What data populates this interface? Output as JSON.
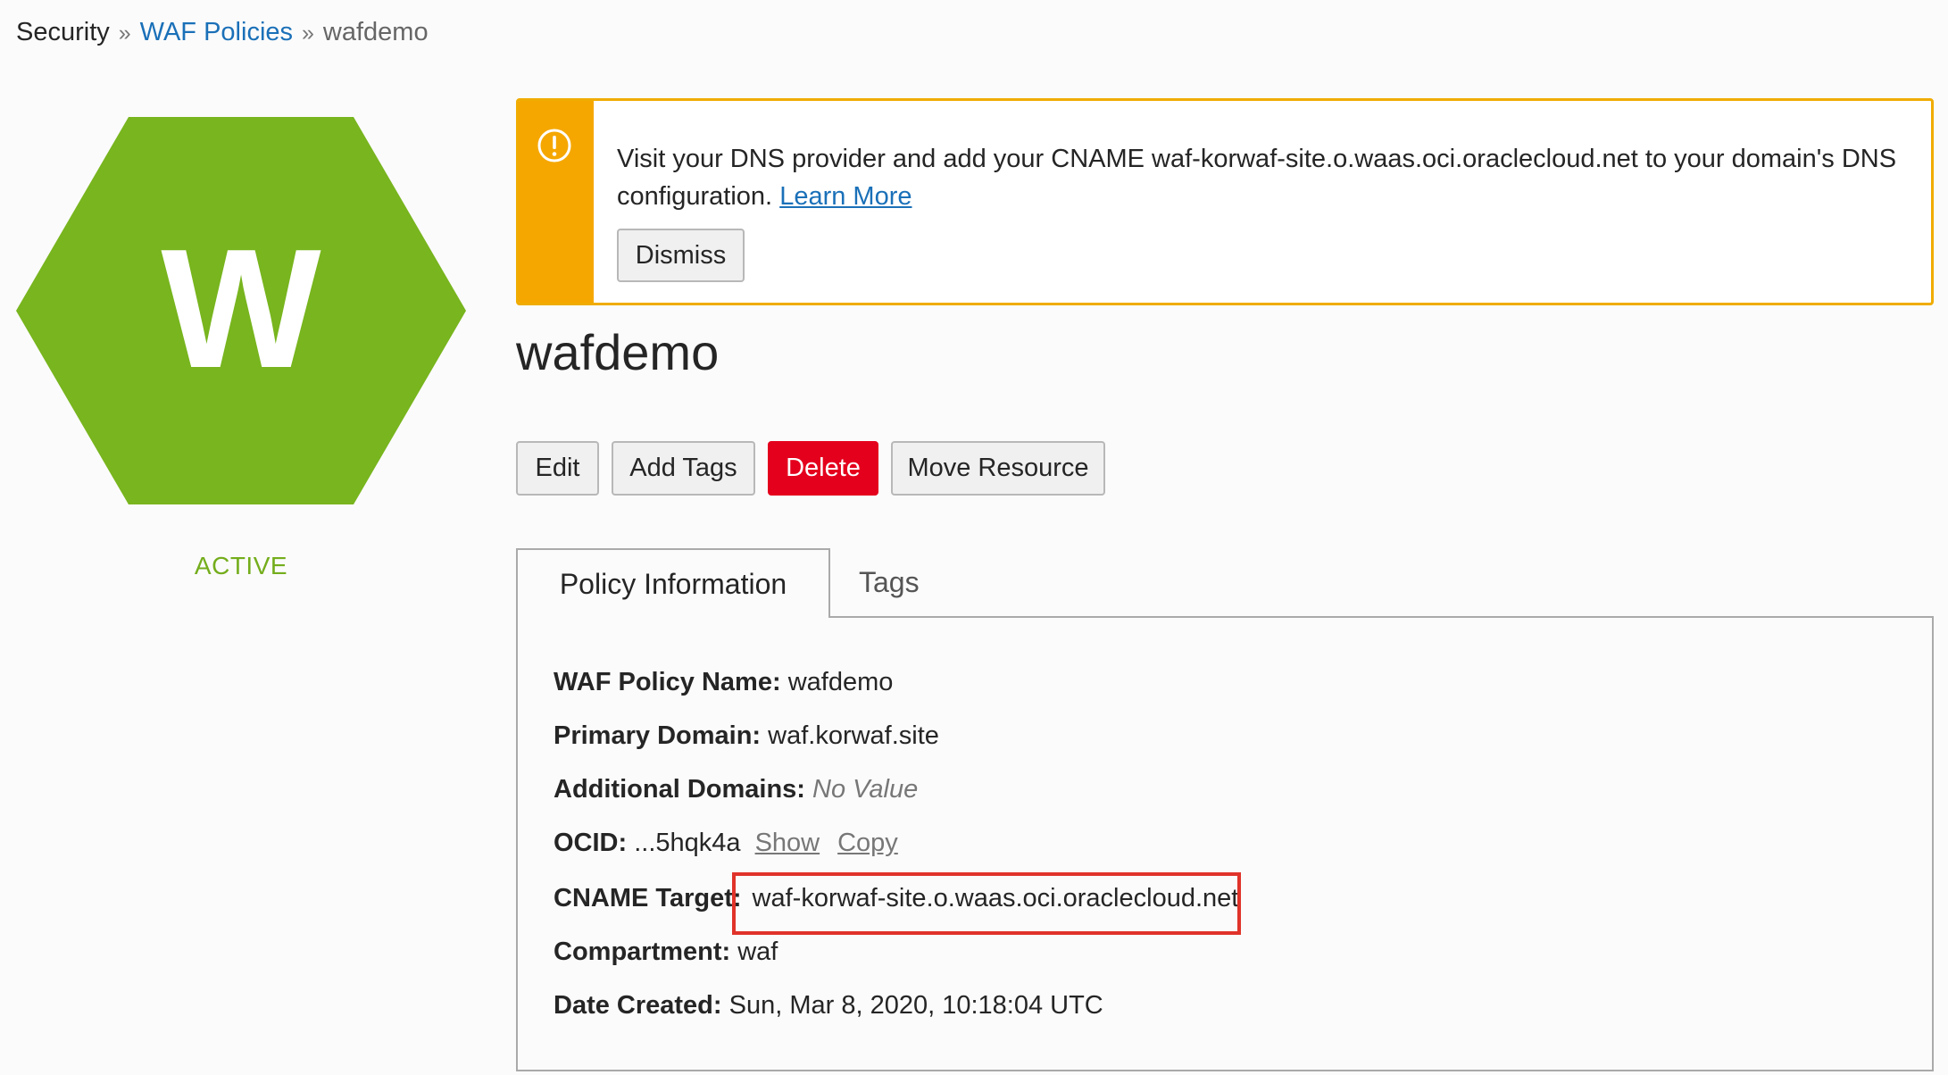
{
  "breadcrumb": {
    "root": "Security",
    "separator": "»",
    "parent": "WAF Policies",
    "current": "wafdemo"
  },
  "resource_icon": {
    "letter": "W",
    "color": "#78b51e",
    "shape": "hexagon"
  },
  "status": {
    "label": "ACTIVE",
    "color": "#74ad1c"
  },
  "banner": {
    "icon": "warning-circle-icon",
    "message": "Visit your DNS provider and add your CNAME waf-korwaf-site.o.waas.oci.oraclecloud.net to your domain's DNS configuration.",
    "link_label": "Learn More",
    "dismiss_label": "Dismiss",
    "accent_color": "#f5a700"
  },
  "title": "wafdemo",
  "actions": {
    "edit": "Edit",
    "add_tags": "Add Tags",
    "delete": "Delete",
    "move_resource": "Move Resource",
    "delete_color": "#e4001d"
  },
  "tabs": [
    {
      "label": "Policy Information",
      "active": true
    },
    {
      "label": "Tags",
      "active": false
    }
  ],
  "details": {
    "waf_policy_name": {
      "label": "WAF Policy Name:",
      "value": "wafdemo"
    },
    "primary_domain": {
      "label": "Primary Domain:",
      "value": "waf.korwaf.site"
    },
    "additional_domains": {
      "label": "Additional Domains:",
      "value": "No Value"
    },
    "ocid": {
      "label": "OCID:",
      "value": "...5hqk4a",
      "show": "Show",
      "copy": "Copy"
    },
    "cname_target": {
      "label": "CNAME Target:",
      "value": "waf-korwaf-site.o.waas.oci.oraclecloud.net"
    },
    "compartment": {
      "label": "Compartment:",
      "value": "waf"
    },
    "date_created": {
      "label": "Date Created:",
      "value": "Sun, Mar 8, 2020, 10:18:04 UTC"
    }
  },
  "annotation_color": "#e0332a"
}
